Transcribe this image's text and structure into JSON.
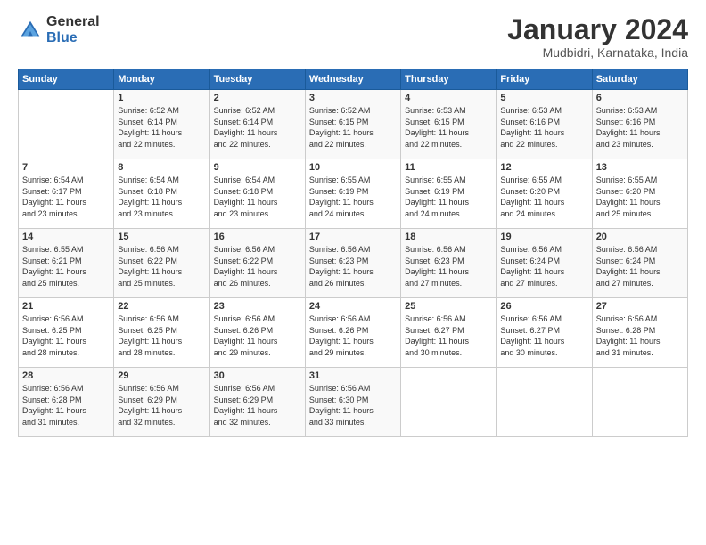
{
  "logo": {
    "general": "General",
    "blue": "Blue"
  },
  "header": {
    "title": "January 2024",
    "subtitle": "Mudbidri, Karnataka, India"
  },
  "days_of_week": [
    "Sunday",
    "Monday",
    "Tuesday",
    "Wednesday",
    "Thursday",
    "Friday",
    "Saturday"
  ],
  "weeks": [
    [
      {
        "day": "",
        "content": ""
      },
      {
        "day": "1",
        "content": "Sunrise: 6:52 AM\nSunset: 6:14 PM\nDaylight: 11 hours\nand 22 minutes."
      },
      {
        "day": "2",
        "content": "Sunrise: 6:52 AM\nSunset: 6:14 PM\nDaylight: 11 hours\nand 22 minutes."
      },
      {
        "day": "3",
        "content": "Sunrise: 6:52 AM\nSunset: 6:15 PM\nDaylight: 11 hours\nand 22 minutes."
      },
      {
        "day": "4",
        "content": "Sunrise: 6:53 AM\nSunset: 6:15 PM\nDaylight: 11 hours\nand 22 minutes."
      },
      {
        "day": "5",
        "content": "Sunrise: 6:53 AM\nSunset: 6:16 PM\nDaylight: 11 hours\nand 22 minutes."
      },
      {
        "day": "6",
        "content": "Sunrise: 6:53 AM\nSunset: 6:16 PM\nDaylight: 11 hours\nand 23 minutes."
      }
    ],
    [
      {
        "day": "7",
        "content": "Sunrise: 6:54 AM\nSunset: 6:17 PM\nDaylight: 11 hours\nand 23 minutes."
      },
      {
        "day": "8",
        "content": "Sunrise: 6:54 AM\nSunset: 6:18 PM\nDaylight: 11 hours\nand 23 minutes."
      },
      {
        "day": "9",
        "content": "Sunrise: 6:54 AM\nSunset: 6:18 PM\nDaylight: 11 hours\nand 23 minutes."
      },
      {
        "day": "10",
        "content": "Sunrise: 6:55 AM\nSunset: 6:19 PM\nDaylight: 11 hours\nand 24 minutes."
      },
      {
        "day": "11",
        "content": "Sunrise: 6:55 AM\nSunset: 6:19 PM\nDaylight: 11 hours\nand 24 minutes."
      },
      {
        "day": "12",
        "content": "Sunrise: 6:55 AM\nSunset: 6:20 PM\nDaylight: 11 hours\nand 24 minutes."
      },
      {
        "day": "13",
        "content": "Sunrise: 6:55 AM\nSunset: 6:20 PM\nDaylight: 11 hours\nand 25 minutes."
      }
    ],
    [
      {
        "day": "14",
        "content": "Sunrise: 6:55 AM\nSunset: 6:21 PM\nDaylight: 11 hours\nand 25 minutes."
      },
      {
        "day": "15",
        "content": "Sunrise: 6:56 AM\nSunset: 6:22 PM\nDaylight: 11 hours\nand 25 minutes."
      },
      {
        "day": "16",
        "content": "Sunrise: 6:56 AM\nSunset: 6:22 PM\nDaylight: 11 hours\nand 26 minutes."
      },
      {
        "day": "17",
        "content": "Sunrise: 6:56 AM\nSunset: 6:23 PM\nDaylight: 11 hours\nand 26 minutes."
      },
      {
        "day": "18",
        "content": "Sunrise: 6:56 AM\nSunset: 6:23 PM\nDaylight: 11 hours\nand 27 minutes."
      },
      {
        "day": "19",
        "content": "Sunrise: 6:56 AM\nSunset: 6:24 PM\nDaylight: 11 hours\nand 27 minutes."
      },
      {
        "day": "20",
        "content": "Sunrise: 6:56 AM\nSunset: 6:24 PM\nDaylight: 11 hours\nand 27 minutes."
      }
    ],
    [
      {
        "day": "21",
        "content": "Sunrise: 6:56 AM\nSunset: 6:25 PM\nDaylight: 11 hours\nand 28 minutes."
      },
      {
        "day": "22",
        "content": "Sunrise: 6:56 AM\nSunset: 6:25 PM\nDaylight: 11 hours\nand 28 minutes."
      },
      {
        "day": "23",
        "content": "Sunrise: 6:56 AM\nSunset: 6:26 PM\nDaylight: 11 hours\nand 29 minutes."
      },
      {
        "day": "24",
        "content": "Sunrise: 6:56 AM\nSunset: 6:26 PM\nDaylight: 11 hours\nand 29 minutes."
      },
      {
        "day": "25",
        "content": "Sunrise: 6:56 AM\nSunset: 6:27 PM\nDaylight: 11 hours\nand 30 minutes."
      },
      {
        "day": "26",
        "content": "Sunrise: 6:56 AM\nSunset: 6:27 PM\nDaylight: 11 hours\nand 30 minutes."
      },
      {
        "day": "27",
        "content": "Sunrise: 6:56 AM\nSunset: 6:28 PM\nDaylight: 11 hours\nand 31 minutes."
      }
    ],
    [
      {
        "day": "28",
        "content": "Sunrise: 6:56 AM\nSunset: 6:28 PM\nDaylight: 11 hours\nand 31 minutes."
      },
      {
        "day": "29",
        "content": "Sunrise: 6:56 AM\nSunset: 6:29 PM\nDaylight: 11 hours\nand 32 minutes."
      },
      {
        "day": "30",
        "content": "Sunrise: 6:56 AM\nSunset: 6:29 PM\nDaylight: 11 hours\nand 32 minutes."
      },
      {
        "day": "31",
        "content": "Sunrise: 6:56 AM\nSunset: 6:30 PM\nDaylight: 11 hours\nand 33 minutes."
      },
      {
        "day": "",
        "content": ""
      },
      {
        "day": "",
        "content": ""
      },
      {
        "day": "",
        "content": ""
      }
    ]
  ]
}
